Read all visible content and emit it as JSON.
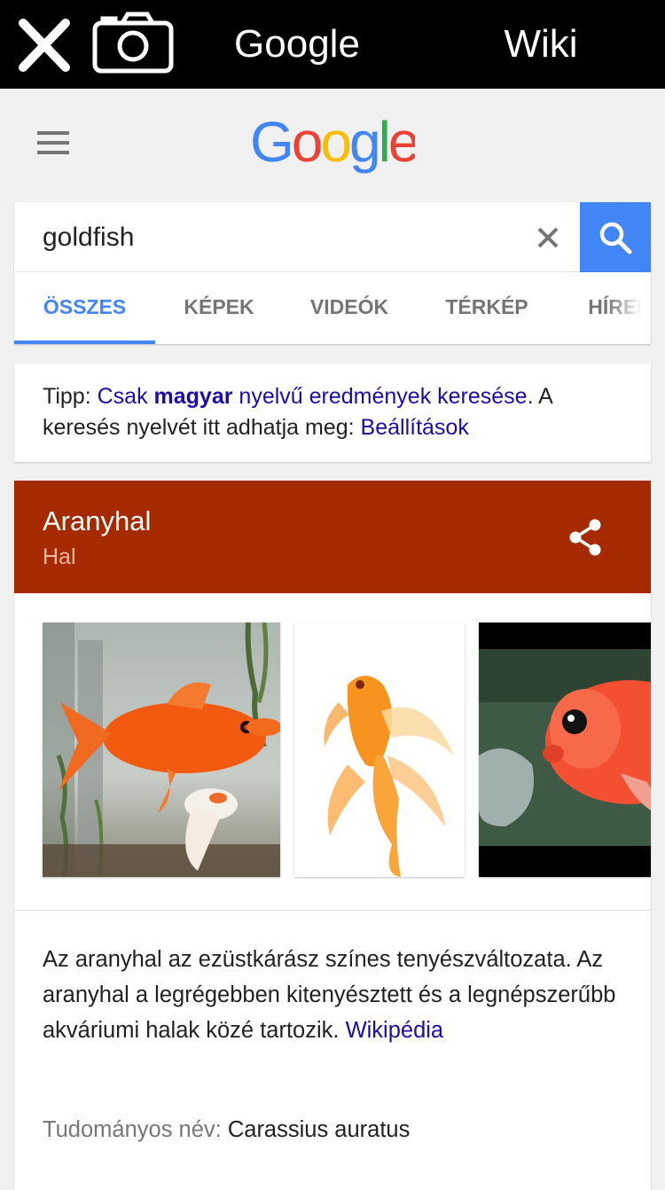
{
  "topbar": {
    "close_icon": "close-icon",
    "camera_icon": "camera-icon",
    "google_label": "Google",
    "wiki_label": "Wiki"
  },
  "header": {
    "menu_icon": "hamburger-menu-icon",
    "logo_text": "Google",
    "logo_colors": [
      "#4285f4",
      "#ea4335",
      "#fbbc05",
      "#4285f4",
      "#34a853",
      "#ea4335"
    ]
  },
  "search": {
    "query": "goldfish",
    "clear_icon": "close-icon",
    "search_icon": "search-icon",
    "accent_color": "#4285f4"
  },
  "tabs": [
    {
      "label": "ÖSSZES",
      "active": true
    },
    {
      "label": "KÉPEK",
      "active": false
    },
    {
      "label": "VIDEÓK",
      "active": false
    },
    {
      "label": "TÉRKÉP",
      "active": false
    },
    {
      "label": "HÍREK",
      "active": false
    }
  ],
  "tip": {
    "prefix": "Tipp: ",
    "link_part1": "Csak ",
    "link_bold": "magyar",
    "link_part2": " nyelvű eredmények keresése",
    "middle": ". A keresés nyelvét itt adhatja meg: ",
    "settings_link": "Beállítások"
  },
  "knowledge_panel": {
    "header_color": "#a52a00",
    "title": "Aranyhal",
    "subtitle": "Hal",
    "share_icon": "share-icon",
    "images": [
      {
        "subject": "goldfish in aquarium"
      },
      {
        "subject": "fancy goldfish on white"
      },
      {
        "subject": "goldfish close-up"
      }
    ],
    "description": "Az aranyhal az ezüstkárász színes tenyészváltozata. Az aranyhal a legrégebben kitenyésztett és a legnépszerűbb akváriumi halak közé tartozik.",
    "source_link": "Wikipédia",
    "fact_label": "Tudományos név:",
    "fact_value": "Carassius auratus"
  }
}
